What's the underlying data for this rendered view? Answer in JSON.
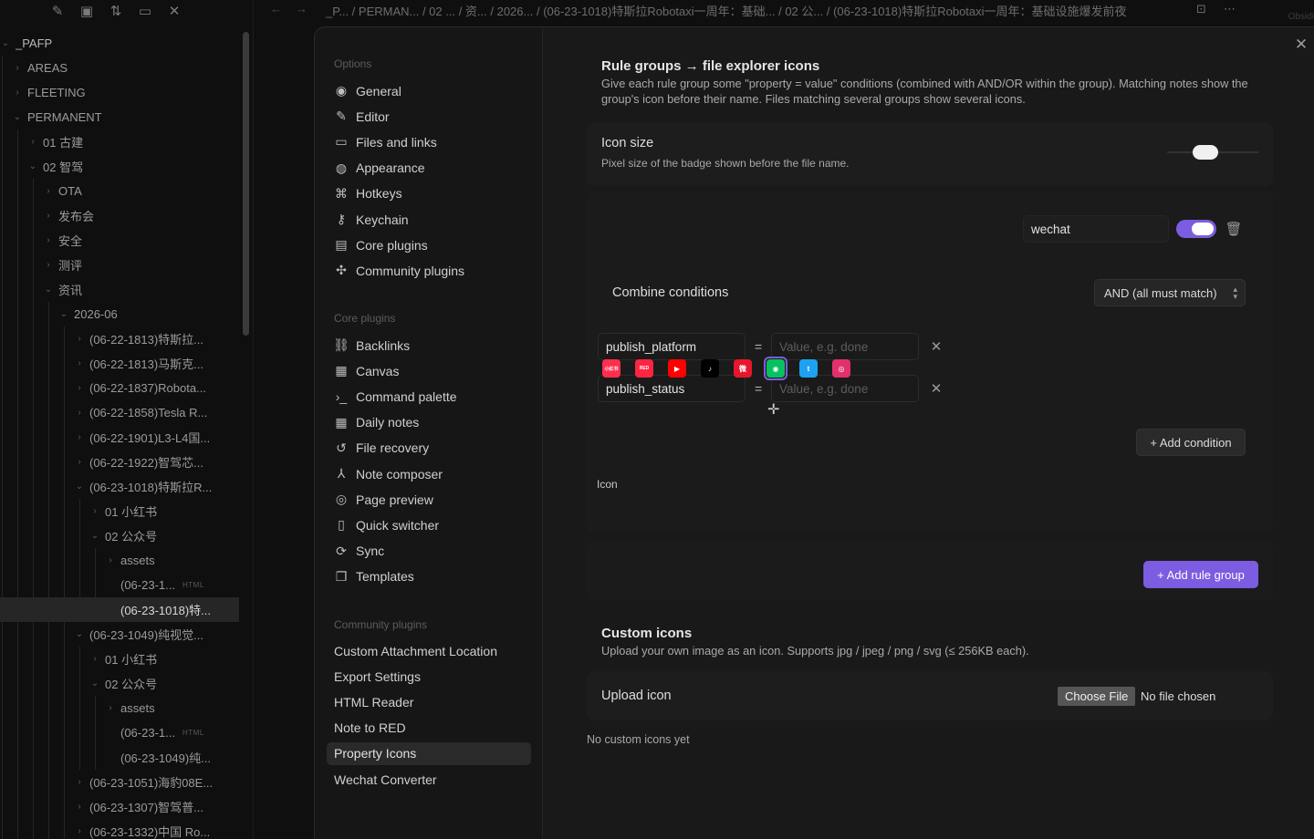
{
  "explorer": {
    "toolbar_icons": [
      "edit-icon",
      "new-folder-icon",
      "sort-icon",
      "collapse-icon",
      "close-icon"
    ],
    "items": [
      {
        "label": "_PAFP",
        "depth": 0,
        "expanded": true
      },
      {
        "label": "AREAS",
        "depth": 1,
        "expanded": false
      },
      {
        "label": "FLEETING",
        "depth": 1,
        "expanded": false
      },
      {
        "label": "PERMANENT",
        "depth": 1,
        "expanded": true
      },
      {
        "label": "01 古建",
        "depth": 2,
        "expanded": false
      },
      {
        "label": "02 智驾",
        "depth": 2,
        "expanded": true
      },
      {
        "label": "OTA",
        "depth": 3,
        "expanded": false
      },
      {
        "label": "发布会",
        "depth": 3,
        "expanded": false
      },
      {
        "label": "安全",
        "depth": 3,
        "expanded": false
      },
      {
        "label": "测评",
        "depth": 3,
        "expanded": false
      },
      {
        "label": "资讯",
        "depth": 3,
        "expanded": true
      },
      {
        "label": "2026-06",
        "depth": 4,
        "expanded": true
      },
      {
        "label": "(06-22-1813)特斯拉...",
        "depth": 5,
        "expanded": false
      },
      {
        "label": "(06-22-1813)马斯克...",
        "depth": 5,
        "expanded": false
      },
      {
        "label": "(06-22-1837)Robota...",
        "depth": 5,
        "expanded": false
      },
      {
        "label": "(06-22-1858)Tesla R...",
        "depth": 5,
        "expanded": false
      },
      {
        "label": "(06-22-1901)L3-L4国...",
        "depth": 5,
        "expanded": false
      },
      {
        "label": "(06-22-1922)智驾芯...",
        "depth": 5,
        "expanded": false
      },
      {
        "label": "(06-23-1018)特斯拉R...",
        "depth": 5,
        "expanded": true
      },
      {
        "label": "01 小红书",
        "depth": 6,
        "expanded": false
      },
      {
        "label": "02 公众号",
        "depth": 6,
        "expanded": true
      },
      {
        "label": "assets",
        "depth": 7,
        "expanded": false
      },
      {
        "label": "(06-23-1...",
        "depth": 7,
        "file": true,
        "badge": "HTML"
      },
      {
        "label": "(06-23-1018)特...",
        "depth": 7,
        "file": true,
        "active": true
      },
      {
        "label": "(06-23-1049)纯视觉...",
        "depth": 5,
        "expanded": true
      },
      {
        "label": "01 小红书",
        "depth": 6,
        "expanded": false
      },
      {
        "label": "02 公众号",
        "depth": 6,
        "expanded": true
      },
      {
        "label": "assets",
        "depth": 7,
        "expanded": false
      },
      {
        "label": "(06-23-1...",
        "depth": 7,
        "file": true,
        "badge": "HTML"
      },
      {
        "label": "(06-23-1049)纯...",
        "depth": 7,
        "file": true
      },
      {
        "label": "(06-23-1051)海豹08E...",
        "depth": 5,
        "expanded": false
      },
      {
        "label": "(06-23-1307)智驾普...",
        "depth": 5,
        "expanded": false
      },
      {
        "label": "(06-23-1332)中国 Ro...",
        "depth": 5,
        "expanded": false
      }
    ]
  },
  "topbar": {
    "crumbs": "_P...  /  PERMAN...  /  02 ...  /  资...  /  2026...  /  (06-23-1018)特斯拉Robotaxi一周年：基础...  /  02 公...  /  (06-23-1018)特斯拉Robotaxi一周年：基础设施爆发前夜",
    "obsidian": "Obsidi"
  },
  "settings": {
    "headings": {
      "options": "Options",
      "core": "Core plugins",
      "community": "Community plugins"
    },
    "options_items": [
      {
        "label": "General",
        "icon": "user-circle-icon"
      },
      {
        "label": "Editor",
        "icon": "pencil-icon"
      },
      {
        "label": "Files and links",
        "icon": "folder-icon"
      },
      {
        "label": "Appearance",
        "icon": "palette-icon"
      },
      {
        "label": "Hotkeys",
        "icon": "command-icon"
      },
      {
        "label": "Keychain",
        "icon": "key-icon"
      },
      {
        "label": "Core plugins",
        "icon": "calendar-plugin-icon"
      },
      {
        "label": "Community plugins",
        "icon": "puzzle-icon"
      }
    ],
    "core_items": [
      {
        "label": "Backlinks",
        "icon": "link-icon"
      },
      {
        "label": "Canvas",
        "icon": "grid-icon"
      },
      {
        "label": "Command palette",
        "icon": "terminal-icon"
      },
      {
        "label": "Daily notes",
        "icon": "calendar-icon"
      },
      {
        "label": "File recovery",
        "icon": "history-icon"
      },
      {
        "label": "Note composer",
        "icon": "merge-icon"
      },
      {
        "label": "Page preview",
        "icon": "eye-icon"
      },
      {
        "label": "Quick switcher",
        "icon": "file-search-icon"
      },
      {
        "label": "Sync",
        "icon": "sync-icon"
      },
      {
        "label": "Templates",
        "icon": "copy-icon"
      }
    ],
    "community_items": [
      {
        "label": "Custom Attachment Location"
      },
      {
        "label": "Export Settings"
      },
      {
        "label": "HTML Reader"
      },
      {
        "label": "Note to RED"
      },
      {
        "label": "Property Icons",
        "active": true
      },
      {
        "label": "Wechat Converter"
      }
    ]
  },
  "content": {
    "rule_groups": {
      "title": "Rule groups → file explorer icons",
      "desc": "Give each rule group some \"property = value\" conditions (combined with AND/OR within the group). Matching notes show the group's icon before their name. Files matching several groups show several icons."
    },
    "icon_size": {
      "name": "Icon size",
      "desc": "Pixel size of the badge shown before the file name.",
      "slider_level": 0.42
    },
    "group": {
      "name_value": "wechat",
      "enabled": true,
      "combine_label": "Combine conditions",
      "combine_value": "AND (all must match)",
      "conditions": [
        {
          "property": "publish_platform",
          "operator": "=",
          "value_placeholder": "Value, e.g. done"
        },
        {
          "property": "publish_status",
          "operator": "=",
          "value_placeholder": "Value, e.g. done"
        }
      ],
      "add_condition": "+ Add condition",
      "icon_label": "Icon",
      "icons": [
        {
          "name": "xiaohongshu-icon",
          "color": "#ff2e4d",
          "glyph": "小红书"
        },
        {
          "name": "red-app-icon",
          "color": "#ff2442",
          "glyph": "RED"
        },
        {
          "name": "youtube-icon",
          "color": "#ff0000",
          "glyph": "▶"
        },
        {
          "name": "tiktok-icon",
          "color": "#000000",
          "glyph": "♪"
        },
        {
          "name": "weibo-icon",
          "color": "#e6162d",
          "glyph": "微"
        },
        {
          "name": "wechat-icon",
          "color": "#07c160",
          "glyph": "◉",
          "selected": true
        },
        {
          "name": "twitter-icon",
          "color": "#1da1f2",
          "glyph": "t"
        },
        {
          "name": "instagram-icon",
          "color": "#e1306c",
          "glyph": "◎"
        }
      ]
    },
    "add_rule_group": "+ Add rule group",
    "custom_icons": {
      "title": "Custom icons",
      "desc": "Upload your own image as an icon. Supports jpg / jpeg / png / svg (≤ 256KB each).",
      "upload_label": "Upload icon",
      "choose_file": "Choose File",
      "no_file": "No file chosen",
      "empty_text": "No custom icons yet"
    }
  },
  "colors": {
    "accent": "#7c5ce0",
    "background": "#191919",
    "sidebar": "#161616"
  }
}
